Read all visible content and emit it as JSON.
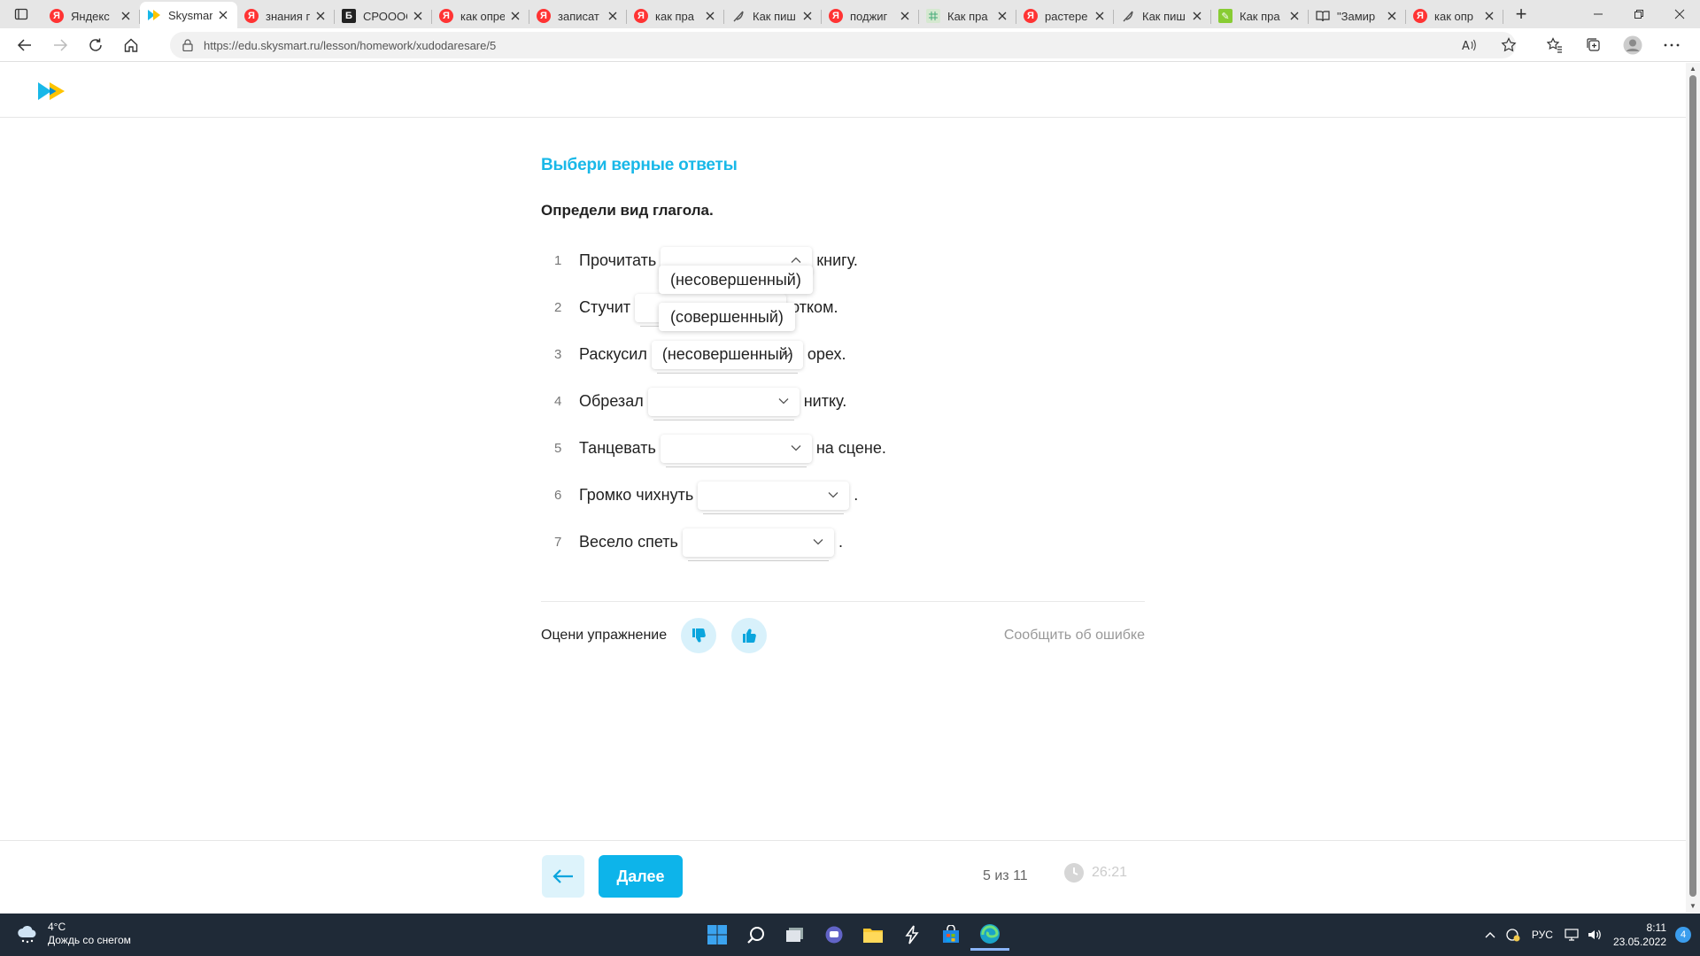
{
  "browser": {
    "tabs": [
      {
        "title": "Яндекс",
        "favicon": "yandex-icon",
        "color": "#f33"
      },
      {
        "title": "Skysmart",
        "favicon": "skysmart-icon",
        "color": "#19b8e8",
        "active": true
      },
      {
        "title": "знания п",
        "favicon": "yandex-icon",
        "color": "#f33"
      },
      {
        "title": "СРООООС",
        "favicon": "b-icon",
        "color": "#222"
      },
      {
        "title": "как опре",
        "favicon": "yandex-icon",
        "color": "#f33"
      },
      {
        "title": "записат",
        "favicon": "yandex-icon",
        "color": "#f33"
      },
      {
        "title": "как пра",
        "favicon": "yandex-icon",
        "color": "#f33"
      },
      {
        "title": "Как пиш",
        "favicon": "feather-icon",
        "color": "#666"
      },
      {
        "title": "поджиг",
        "favicon": "yandex-icon",
        "color": "#f33"
      },
      {
        "title": "Как пра",
        "favicon": "grid-icon",
        "color": "#7a9"
      },
      {
        "title": "растере",
        "favicon": "yandex-icon",
        "color": "#f33"
      },
      {
        "title": "Как пиш",
        "favicon": "feather-icon",
        "color": "#666"
      },
      {
        "title": "Как пра",
        "favicon": "pencil-icon",
        "color": "#8c3"
      },
      {
        "title": "\"Замир",
        "favicon": "book-icon",
        "color": "#444"
      },
      {
        "title": "как опр",
        "favicon": "yandex-icon",
        "color": "#f33"
      }
    ],
    "url": "https://edu.skysmart.ru/lesson/homework/xudodaresare/5"
  },
  "task": {
    "title": "Выбери верные ответы",
    "question": "Определи вид глагола.",
    "rows": [
      {
        "num": "1",
        "pre": "Прочитать",
        "value": "",
        "post": "книгу.",
        "open": true
      },
      {
        "num": "2",
        "pre": "Стучит",
        "value": "",
        "post": "отком."
      },
      {
        "num": "3",
        "pre": "Раскусил",
        "value": "(несовершенный)",
        "post": "орех."
      },
      {
        "num": "4",
        "pre": "Обрезал",
        "value": "",
        "post": "нитку."
      },
      {
        "num": "5",
        "pre": "Танцевать",
        "value": "",
        "post": "на сцене."
      },
      {
        "num": "6",
        "pre": "Громко чихнуть",
        "value": "",
        "post": "."
      },
      {
        "num": "7",
        "pre": "Весело спеть",
        "value": "",
        "post": "."
      }
    ],
    "options": [
      "(несовершенный)",
      "(совершенный)"
    ]
  },
  "rating": {
    "label": "Оцени упражнение",
    "report": "Сообщить об ошибке"
  },
  "footer": {
    "next_label": "Далее",
    "progress": "5 из 11",
    "timer": "26:21"
  },
  "taskbar": {
    "temp": "4°C",
    "weather": "Дождь со снегом",
    "lang": "РУС",
    "time": "8:11",
    "date": "23.05.2022",
    "notifications": "4"
  },
  "colors": {
    "accent": "#19b8e8",
    "button": "#0db4ea"
  }
}
